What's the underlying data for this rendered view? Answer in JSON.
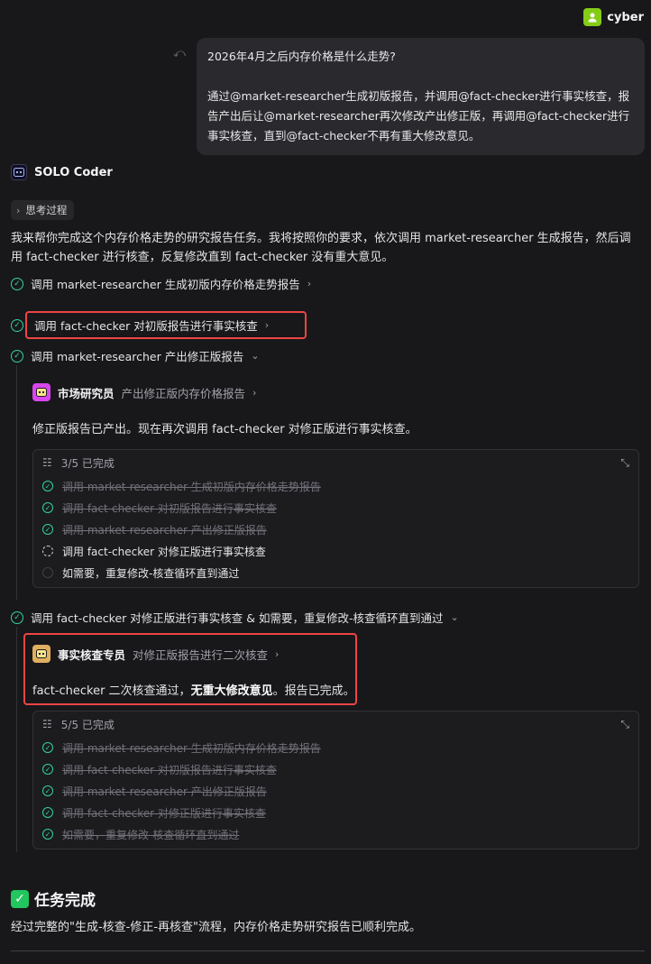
{
  "user": {
    "name": "cyber"
  },
  "message": {
    "line1": "2026年4月之后内存价格是什么走势?",
    "line2": "通过@market-researcher生成初版报告，并调用@fact-checker进行事实核查，报告产出后让@market-researcher再次修改产出修正版，再调用@fact-checker进行事实核查，直到@fact-checker不再有重大修改意见。"
  },
  "agent": {
    "name": "SOLO Coder",
    "thinking_label": "思考过程"
  },
  "intro": "我来帮你完成这个内存价格走势的研究报告任务。我将按照你的要求，依次调用 market-researcher 生成报告，然后调用 fact-checker 进行核查，反复修改直到 fact-checker 没有重大意见。",
  "steps": [
    {
      "label": "调用 market-researcher 生成初版内存价格走势报告"
    },
    {
      "label": "调用 fact-checker 对初版报告进行事实核查"
    },
    {
      "label": "调用 market-researcher 产出修正版报告"
    },
    {
      "label": "调用 fact-checker 对修正版进行事实核查 & 如需要，重复修改-核查循环直到通过"
    }
  ],
  "subagent1": {
    "name": "市场研究员",
    "task": "产出修正版内存价格报告"
  },
  "revision_text": "修正版报告已产出。现在再次调用 fact-checker 对修正版进行事实核查。",
  "todo1": {
    "status": "3/5 已完成",
    "items": [
      "调用 market-researcher 生成初版内存价格走势报告",
      "调用 fact-checker 对初版报告进行事实核查",
      "调用 market-researcher 产出修正版报告",
      "调用 fact-checker 对修正版进行事实核查",
      "如需要，重复修改-核查循环直到通过"
    ]
  },
  "subagent2": {
    "name": "事实核查专员",
    "task": "对修正版报告进行二次核查"
  },
  "result": {
    "prefix": "fact-checker 二次核查通过，",
    "bold": "无重大修改意见",
    "suffix": "。报告已完成。"
  },
  "todo2": {
    "status": "5/5 已完成",
    "items": [
      "调用 market-researcher 生成初版内存价格走势报告",
      "调用 fact-checker 对初版报告进行事实核查",
      "调用 market-researcher 产出修正版报告",
      "调用 fact-checker 对修正版进行事实核查",
      "如需要，重复修改-核查循环直到通过"
    ]
  },
  "final": {
    "heading": "任务完成",
    "text": "经过完整的\"生成-核查-修正-再核查\"流程，内存价格走势研究报告已顺利完成。"
  },
  "colors": {
    "accent_green": "#34d399",
    "highlight_red": "#ef4444",
    "background": "#18181b"
  }
}
